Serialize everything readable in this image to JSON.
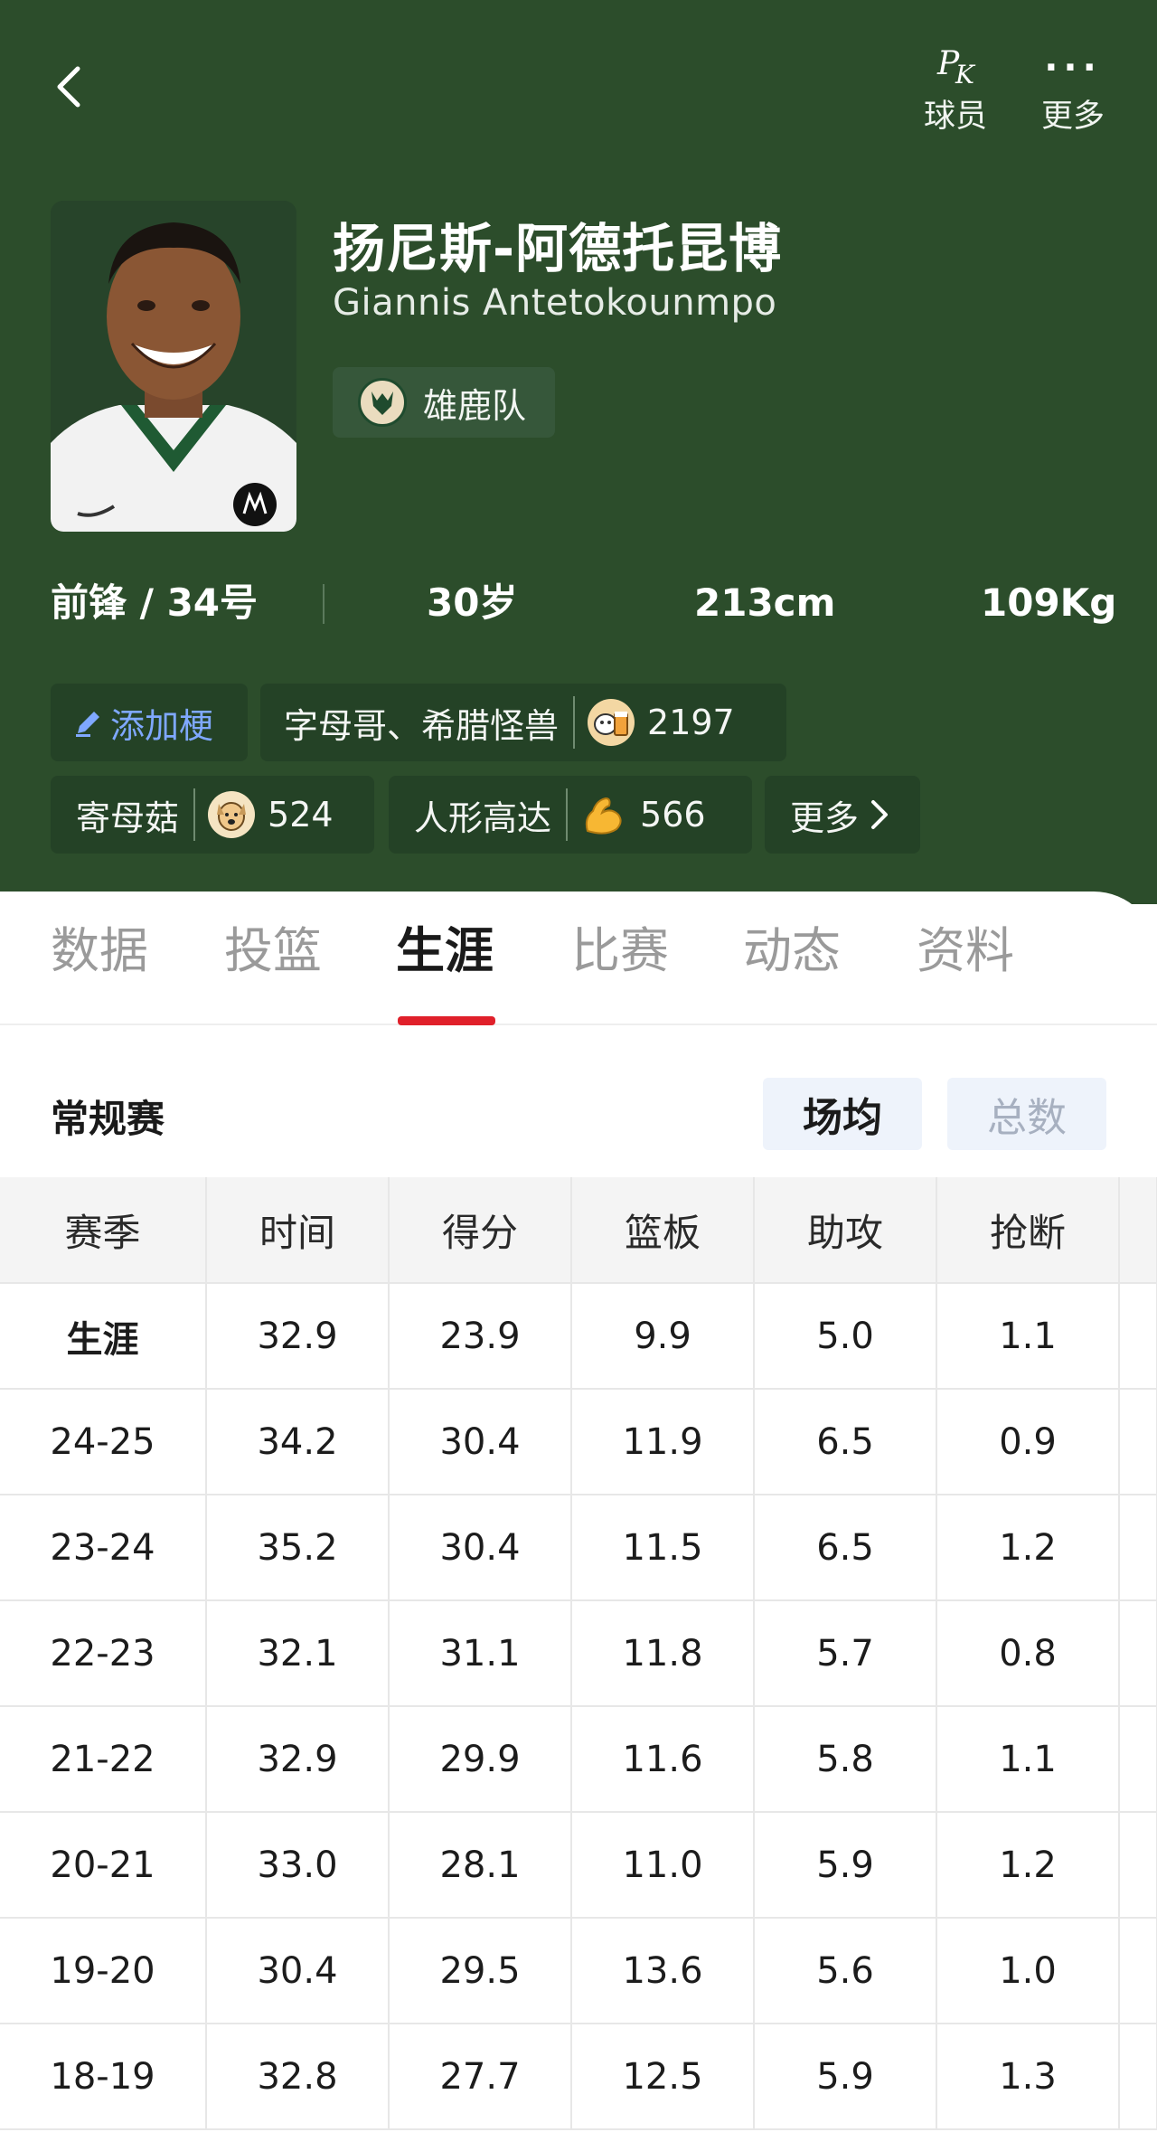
{
  "header": {
    "pk_label": "球员",
    "more_label": "更多",
    "name_cn": "扬尼斯-阿德托昆博",
    "name_en": "Giannis Antetokounmpo",
    "team": "雄鹿队"
  },
  "profile": {
    "position_number": "前锋 / 34号",
    "age": "30岁",
    "height": "213cm",
    "weight": "109Kg"
  },
  "tags": {
    "add_label": "添加梗",
    "items": [
      {
        "text": "字母哥、希腊怪兽",
        "icon": "beer-cow-icon",
        "count": "2197"
      },
      {
        "text": "寄母菇",
        "icon": "dog-face-icon",
        "count": "524"
      },
      {
        "text": "人形高达",
        "icon": "flexed-biceps-icon",
        "count": "566"
      }
    ],
    "more_label": "更多"
  },
  "tabs": [
    "数据",
    "投篮",
    "生涯",
    "比赛",
    "动态",
    "资料"
  ],
  "active_tab": "生涯",
  "section": {
    "title": "常规赛",
    "mode_on": "场均",
    "mode_off": "总数"
  },
  "table": {
    "headers": [
      "赛季",
      "时间",
      "得分",
      "篮板",
      "助攻",
      "抢断"
    ],
    "rows": [
      [
        "生涯",
        "32.9",
        "23.9",
        "9.9",
        "5.0",
        "1.1"
      ],
      [
        "24-25",
        "34.2",
        "30.4",
        "11.9",
        "6.5",
        "0.9"
      ],
      [
        "23-24",
        "35.2",
        "30.4",
        "11.5",
        "6.5",
        "1.2"
      ],
      [
        "22-23",
        "32.1",
        "31.1",
        "11.8",
        "5.7",
        "0.8"
      ],
      [
        "21-22",
        "32.9",
        "29.9",
        "11.6",
        "5.8",
        "1.1"
      ],
      [
        "20-21",
        "33.0",
        "28.1",
        "11.0",
        "5.9",
        "1.2"
      ],
      [
        "19-20",
        "30.4",
        "29.5",
        "13.6",
        "5.6",
        "1.0"
      ],
      [
        "18-19",
        "32.8",
        "27.7",
        "12.5",
        "5.9",
        "1.3"
      ]
    ]
  },
  "colors": {
    "header_bg": "#2c4d2b",
    "tab_indicator": "#e0202a",
    "add_tag_text": "#7fa8ff"
  }
}
